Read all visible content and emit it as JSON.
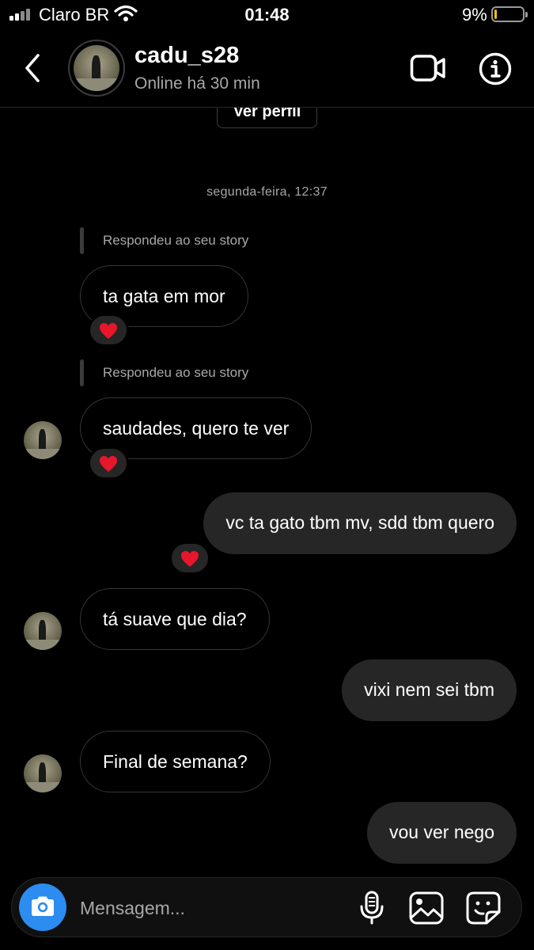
{
  "status_bar": {
    "carrier": "Claro BR",
    "time": "01:48",
    "battery": "9%",
    "battery_level": 0.09,
    "battery_color": "#f2c500"
  },
  "header": {
    "back_icon": "chevron-left-icon",
    "username": "cadu_s28",
    "status": "Online há 30 min",
    "video_icon": "video-camera-icon",
    "info_icon": "info-icon"
  },
  "chat": {
    "view_profile_label": "Ver perfil",
    "date_label": "segunda-feira, 12:37",
    "messages": [
      {
        "direction": "in",
        "reply_note": "Respondeu ao seu story",
        "text": "ta gata em mor",
        "reaction": "❤️"
      },
      {
        "direction": "in",
        "reply_note": "Respondeu ao seu story",
        "text": "saudades, quero te ver",
        "reaction": "❤️"
      },
      {
        "direction": "out",
        "text": "vc ta gato tbm mv, sdd tbm quero",
        "reaction": "❤️"
      },
      {
        "direction": "in",
        "text": "tá suave que dia?"
      },
      {
        "direction": "out",
        "text": "vixi nem sei tbm"
      },
      {
        "direction": "in",
        "text": "Final de semana?"
      },
      {
        "direction": "out",
        "text": "vou ver nego"
      }
    ]
  },
  "composer": {
    "placeholder": "Mensagem...",
    "camera_icon": "camera-icon",
    "mic_icon": "microphone-icon",
    "gallery_icon": "image-gallery-icon",
    "sticker_icon": "sticker-icon",
    "accent_color": "#2d8cf0"
  },
  "colors": {
    "background": "#000000",
    "outgoing_bubble": "#262626",
    "incoming_border": "#363636",
    "secondary_text": "#a8a8a8"
  }
}
